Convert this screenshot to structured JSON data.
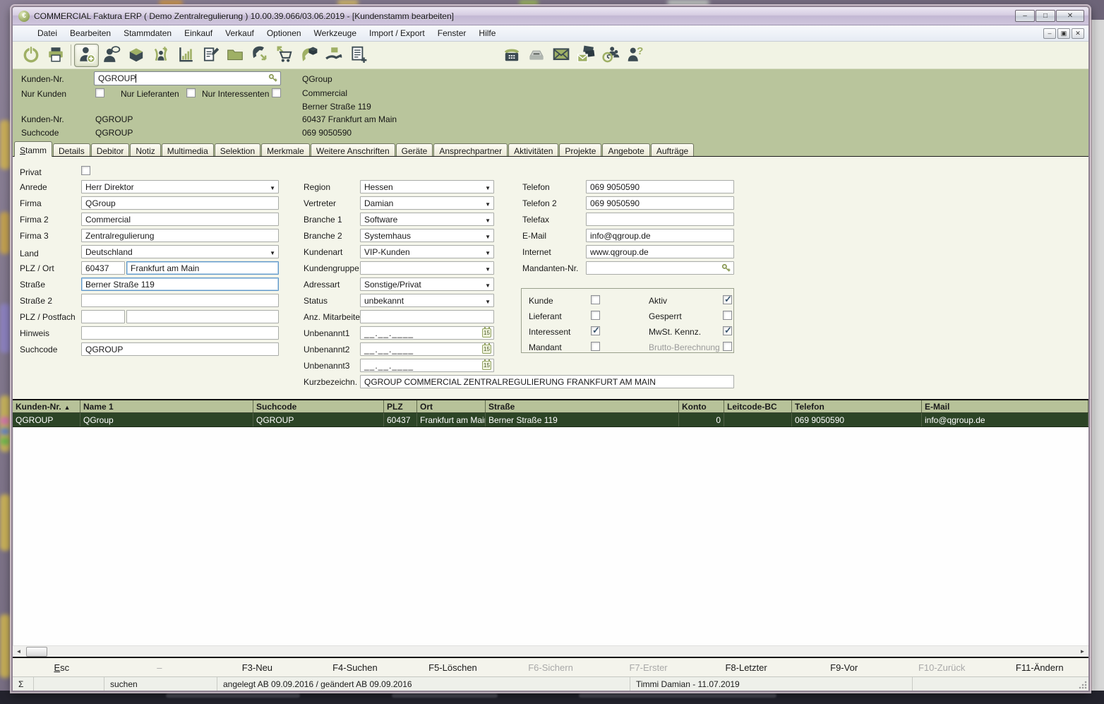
{
  "colors": {
    "accent_olive": "#9fb065",
    "icon_dark": "#3c4b52",
    "panel_green": "#b9c59c",
    "selected_row_green": "#2c4426",
    "titlebar_lavender": "#cfc6dd"
  },
  "window": {
    "title": "COMMERCIAL Faktura ERP  ( Demo Zentralregulierung ) 10.00.39.066/03.06.2019  - [Kundenstamm bearbeiten]",
    "controls": [
      "minimize",
      "maximize",
      "close"
    ],
    "mdi_controls": [
      "minimize",
      "restore",
      "close"
    ]
  },
  "menu": {
    "items": [
      "Datei",
      "Bearbeiten",
      "Stammdaten",
      "Einkauf",
      "Verkauf",
      "Optionen",
      "Werkzeuge",
      "Import / Export",
      "Fenster",
      "Hilfe"
    ]
  },
  "toolbar": {
    "left_icons": [
      "exit",
      "print",
      "customer-new",
      "contact-lookup",
      "article-stock",
      "customer-acquisition",
      "statistics",
      "document-edit",
      "folder-open",
      "call-incoming",
      "purchase-order",
      "delivery-call",
      "goods-receipt",
      "document-new"
    ],
    "right_icons": [
      "telephone",
      "fax",
      "email",
      "email-send-receive",
      "team-schedule",
      "support-contact"
    ],
    "active_icon": "customer-new"
  },
  "search_panel": {
    "kunden_nr_label": "Kunden-Nr.",
    "kunden_nr_input": "QGROUP",
    "filters": [
      {
        "label": "Nur Kunden",
        "checked": false
      },
      {
        "label": "Nur Lieferanten",
        "checked": false
      },
      {
        "label": "Nur Interessenten",
        "checked": false
      }
    ],
    "info_left": [
      {
        "label": "Kunden-Nr.",
        "value": "QGROUP"
      },
      {
        "label": "Suchcode",
        "value": "QGROUP"
      }
    ],
    "address": [
      "QGroup",
      "Commercial",
      "Berner Straße 119",
      "60437 Frankfurt am Main",
      "069 9050590"
    ]
  },
  "tabs": [
    "Stamm",
    "Details",
    "Debitor",
    "Notiz",
    "Multimedia",
    "Selektion",
    "Merkmale",
    "Weitere Anschriften",
    "Geräte",
    "Ansprechpartner",
    "Aktivitäten",
    "Projekte",
    "Angebote",
    "Aufträge"
  ],
  "active_tab": "Stamm",
  "form": {
    "calendar_day": "15",
    "left": [
      {
        "label": "Privat",
        "checked": false
      },
      {
        "label": "Anrede",
        "value": "Herr Direktor"
      },
      {
        "label": "Firma",
        "value": "QGroup"
      },
      {
        "label": "Firma 2",
        "value": "Commercial"
      },
      {
        "label": "Firma 3",
        "value": "Zentralregulierung"
      },
      {
        "label": "Land",
        "value": "Deutschland"
      },
      {
        "label": "PLZ / Ort",
        "plz": "60437",
        "ort": "Frankfurt am Main"
      },
      {
        "label": "Straße",
        "value": "Berner Straße 119"
      },
      {
        "label": "Straße 2",
        "value": ""
      },
      {
        "label": "PLZ / Postfach",
        "plz": "",
        "postfach": ""
      },
      {
        "label": "Hinweis",
        "value": ""
      },
      {
        "label": "Suchcode",
        "value": "QGROUP"
      }
    ],
    "middle": [
      {
        "label": "Region",
        "value": "Hessen"
      },
      {
        "label": "Vertreter",
        "value": "Damian"
      },
      {
        "label": "Branche 1",
        "value": "Software"
      },
      {
        "label": "Branche 2",
        "value": "Systemhaus"
      },
      {
        "label": "Kundenart",
        "value": "VIP-Kunden"
      },
      {
        "label": "Kundengruppe",
        "value": ""
      },
      {
        "label": "Adressart",
        "value": "Sonstige/Privat"
      },
      {
        "label": "Status",
        "value": "unbekannt"
      },
      {
        "label": "Anz. Mitarbeiter",
        "value": ""
      },
      {
        "label": "Unbenannt1",
        "value": "__.__.____"
      },
      {
        "label": "Unbenannt2",
        "value": "__.__.____"
      },
      {
        "label": "Unbenannt3",
        "value": "__.__.____"
      },
      {
        "label": "Kurzbezeichn.",
        "value": "QGROUP COMMERCIAL ZENTRALREGULIERUNG FRANKFURT AM MAIN"
      }
    ],
    "right": [
      {
        "label": "Telefon",
        "value": "069 9050590"
      },
      {
        "label": "Telefon 2",
        "value": "069 9050590"
      },
      {
        "label": "Telefax",
        "value": ""
      },
      {
        "label": "E-Mail",
        "value": "info@qgroup.de"
      },
      {
        "label": "Internet",
        "value": "www.qgroup.de"
      },
      {
        "label": "Mandanten-Nr.",
        "value": ""
      }
    ],
    "flags": {
      "left": [
        {
          "label": "Kunde",
          "checked": false
        },
        {
          "label": "Lieferant",
          "checked": false
        },
        {
          "label": "Interessent",
          "checked": true
        },
        {
          "label": "Mandant",
          "checked": false
        }
      ],
      "right": [
        {
          "label": "Aktiv",
          "checked": true
        },
        {
          "label": "Gesperrt",
          "checked": false
        },
        {
          "label": "MwSt. Kennz.",
          "checked": true
        },
        {
          "label": "Brutto-Berechnung",
          "checked": false,
          "disabled": true
        }
      ]
    }
  },
  "results_table": {
    "columns": [
      "Kunden-Nr.",
      "Name 1",
      "Suchcode",
      "PLZ",
      "Ort",
      "Straße",
      "Konto",
      "Leitcode-BC",
      "Telefon",
      "E-Mail"
    ],
    "sort_column": "Kunden-Nr.",
    "sort_arrow": "▲",
    "rows": [
      [
        "QGROUP",
        "QGroup",
        "QGROUP",
        "60437",
        "Frankfurt am Main",
        "Berner Straße 119",
        "0",
        "",
        "069 9050590",
        "info@qgroup.de"
      ]
    ]
  },
  "function_bar": {
    "keys": [
      {
        "label": "Esc",
        "disabled": false
      },
      {
        "label": "–",
        "disabled": true
      },
      {
        "label": "F3-Neu",
        "disabled": false
      },
      {
        "label": "F4-Suchen",
        "disabled": false
      },
      {
        "label": "F5-Löschen",
        "disabled": false
      },
      {
        "label": "F6-Sichern",
        "disabled": true
      },
      {
        "label": "F7-Erster",
        "disabled": true
      },
      {
        "label": "F8-Letzter",
        "disabled": false
      },
      {
        "label": "F9-Vor",
        "disabled": false
      },
      {
        "label": "F10-Zurück",
        "disabled": true
      },
      {
        "label": "F11-Ändern",
        "disabled": false
      }
    ]
  },
  "status_bar": {
    "sigma": "Σ",
    "mode": "suchen",
    "record_info": "angelegt AB 09.09.2016 / geändert AB 09.09.2016",
    "user": "Timmi Damian - 11.07.2019"
  }
}
